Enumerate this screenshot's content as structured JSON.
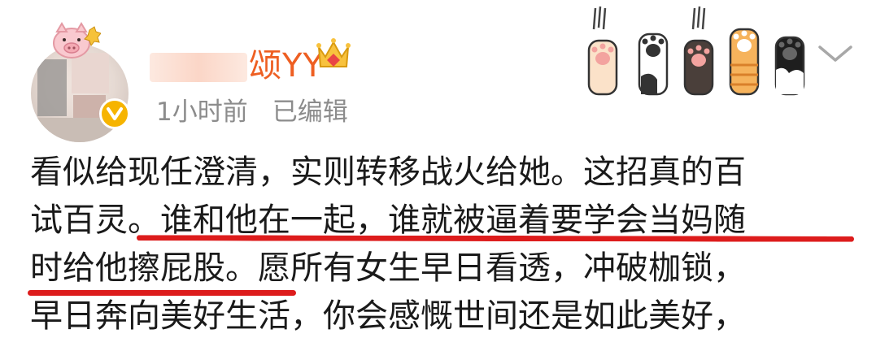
{
  "post": {
    "user": {
      "name_visible": "颂YY",
      "avatar_icon": "avatar-blurred",
      "badge_icon": "verified-v-badge"
    },
    "meta": {
      "time": "1小时前",
      "edited": "已编辑"
    },
    "lines": [
      "看似给现任澄清，实则转移战火给她。这招真的百",
      "试百灵。谁和他在一起，谁就被逼着要学会当妈随",
      "时给他擦屁股。愿所有女生早日看透，冲破枷锁，",
      "早日奔向美好生活，你会感慨世间还是如此美好，"
    ],
    "colors": {
      "username": "#ee5f22",
      "meta": "#8c8c8c",
      "underline": "#dd1c1c",
      "badge": "#f6b400"
    }
  }
}
